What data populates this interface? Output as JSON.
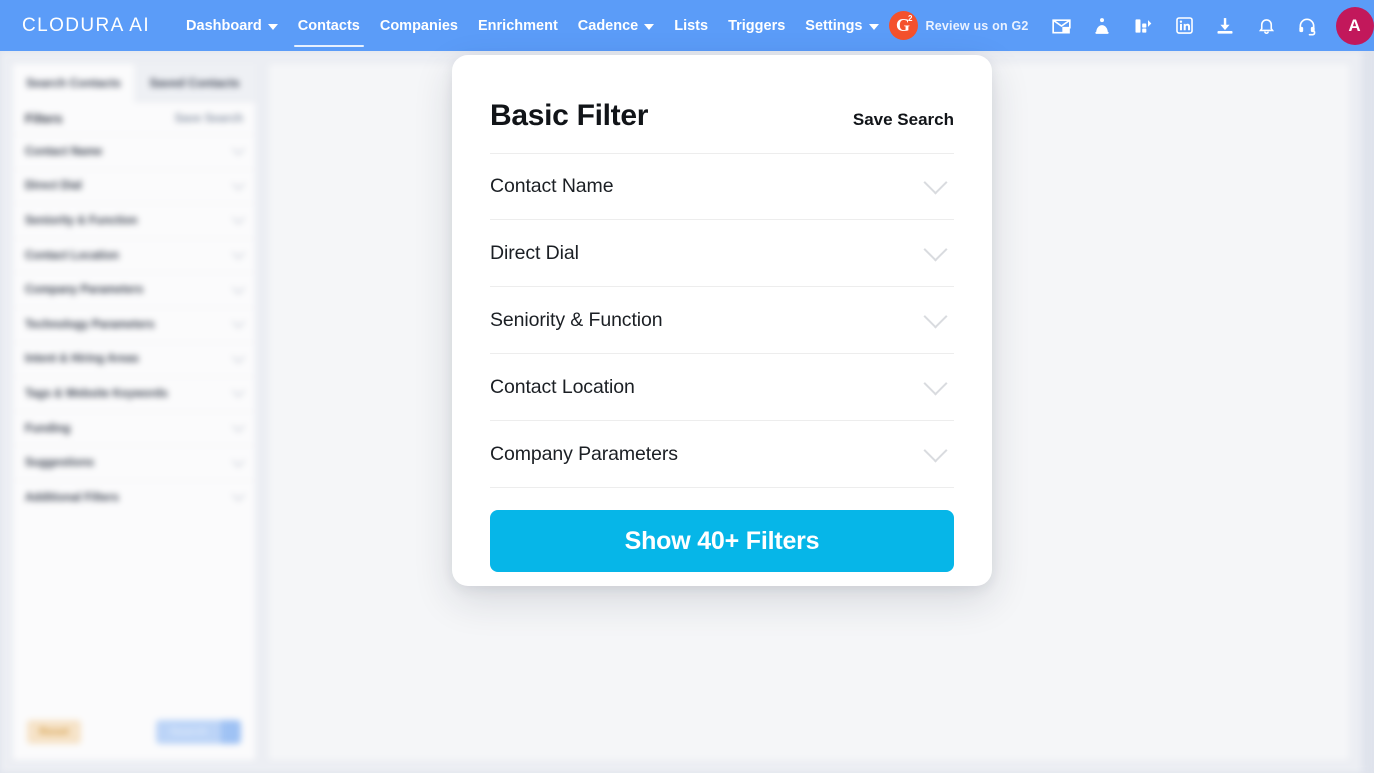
{
  "brand": {
    "name": "CLODURA AI"
  },
  "nav": {
    "items": [
      {
        "label": "Dashboard",
        "has_caret": true,
        "active": false
      },
      {
        "label": "Contacts",
        "has_caret": false,
        "active": true
      },
      {
        "label": "Companies",
        "has_caret": false,
        "active": false
      },
      {
        "label": "Enrichment",
        "has_caret": false,
        "active": false
      },
      {
        "label": "Cadence",
        "has_caret": true,
        "active": false
      },
      {
        "label": "Lists",
        "has_caret": false,
        "active": false
      },
      {
        "label": "Triggers",
        "has_caret": false,
        "active": false
      },
      {
        "label": "Settings",
        "has_caret": true,
        "active": false
      }
    ],
    "g2": {
      "label": "Review us on G2",
      "letter": "G",
      "superscript": "2",
      "color": "#f4512c"
    },
    "icons": [
      "ai-email-icon",
      "ai-assistant-icon",
      "analytics-icon",
      "linkedin-icon",
      "download-icon",
      "notification-bell-icon",
      "support-headset-icon"
    ],
    "avatar": {
      "initial": "A",
      "color": "#c2185b"
    }
  },
  "left_panel": {
    "tabs": [
      {
        "label": "Search Contacts",
        "active": true
      },
      {
        "label": "Saved Contacts",
        "active": false
      }
    ],
    "filters_title": "Filters",
    "save_search_label": "Save Search",
    "rows": [
      {
        "label": "Contact Name"
      },
      {
        "label": "Direct Dial"
      },
      {
        "label": "Seniority & Function"
      },
      {
        "label": "Contact Location"
      },
      {
        "label": "Company Parameters"
      },
      {
        "label": "Technology Parameters"
      },
      {
        "label": "Intent & Hiring Areas"
      },
      {
        "label": "Tags & Website Keywords"
      },
      {
        "label": "Funding"
      },
      {
        "label": "Suggestions"
      },
      {
        "label": "Additional Filters"
      }
    ],
    "reset_label": "Reset",
    "search_label": "Search"
  },
  "modal": {
    "title": "Basic Filter",
    "save_search_label": "Save Search",
    "rows": [
      {
        "label": "Contact Name"
      },
      {
        "label": "Direct Dial"
      },
      {
        "label": "Seniority & Function"
      },
      {
        "label": "Contact Location"
      },
      {
        "label": "Company Parameters"
      }
    ],
    "cta_label": "Show 40+ Filters",
    "cta_color": "#06b6e8"
  }
}
